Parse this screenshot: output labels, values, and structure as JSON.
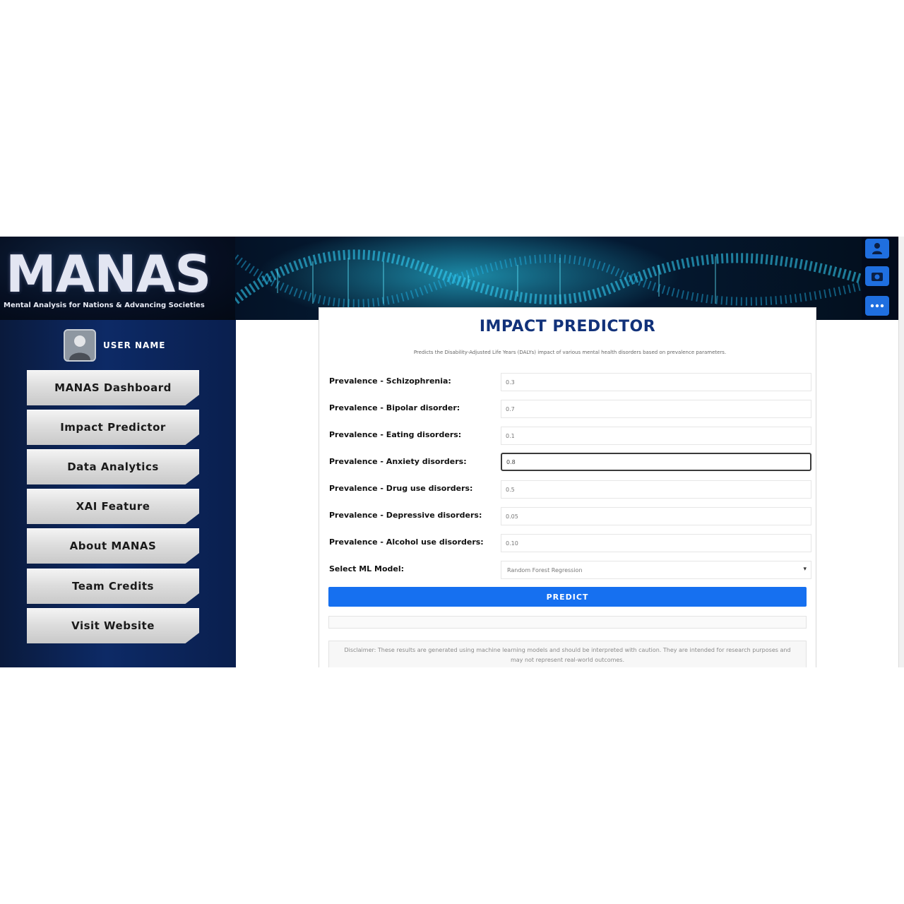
{
  "header": {
    "logo": "MANAS",
    "tagline": "Mental Analysis for Nations & Advancing Societies"
  },
  "sidebar": {
    "user_name": "USER NAME",
    "items": [
      {
        "label": "MANAS Dashboard"
      },
      {
        "label": "Impact Predictor"
      },
      {
        "label": "Data Analytics"
      },
      {
        "label": "XAI Feature"
      },
      {
        "label": "About MANAS"
      },
      {
        "label": "Team Credits"
      },
      {
        "label": "Visit Website"
      }
    ]
  },
  "form": {
    "title": "IMPACT PREDICTOR",
    "description": "Predicts the Disability-Adjusted Life Years (DALYs) impact of various mental health disorders based on prevalence parameters.",
    "fields": [
      {
        "label": "Prevalence - Schizophrenia:",
        "value": "0.3"
      },
      {
        "label": "Prevalence - Bipolar disorder:",
        "value": "0.7"
      },
      {
        "label": "Prevalence - Eating disorders:",
        "value": "0.1"
      },
      {
        "label": "Prevalence - Anxiety disorders:",
        "value": "0.8"
      },
      {
        "label": "Prevalence - Drug use disorders:",
        "value": "0.5"
      },
      {
        "label": "Prevalence - Depressive disorders:",
        "value": "0.05"
      },
      {
        "label": "Prevalence - Alcohol use disorders:",
        "value": "0.10"
      }
    ],
    "model_label": "Select ML Model:",
    "model_value": "Random Forest Regression",
    "predict_label": "PREDICT",
    "disclaimer": "Disclaimer: These results are generated using machine learning models and should be interpreted with caution. They are intended for research purposes and may not represent real-world outcomes."
  },
  "colors": {
    "accent": "#1670f0",
    "title": "#12327a",
    "sidebar": "#0d2a66"
  }
}
